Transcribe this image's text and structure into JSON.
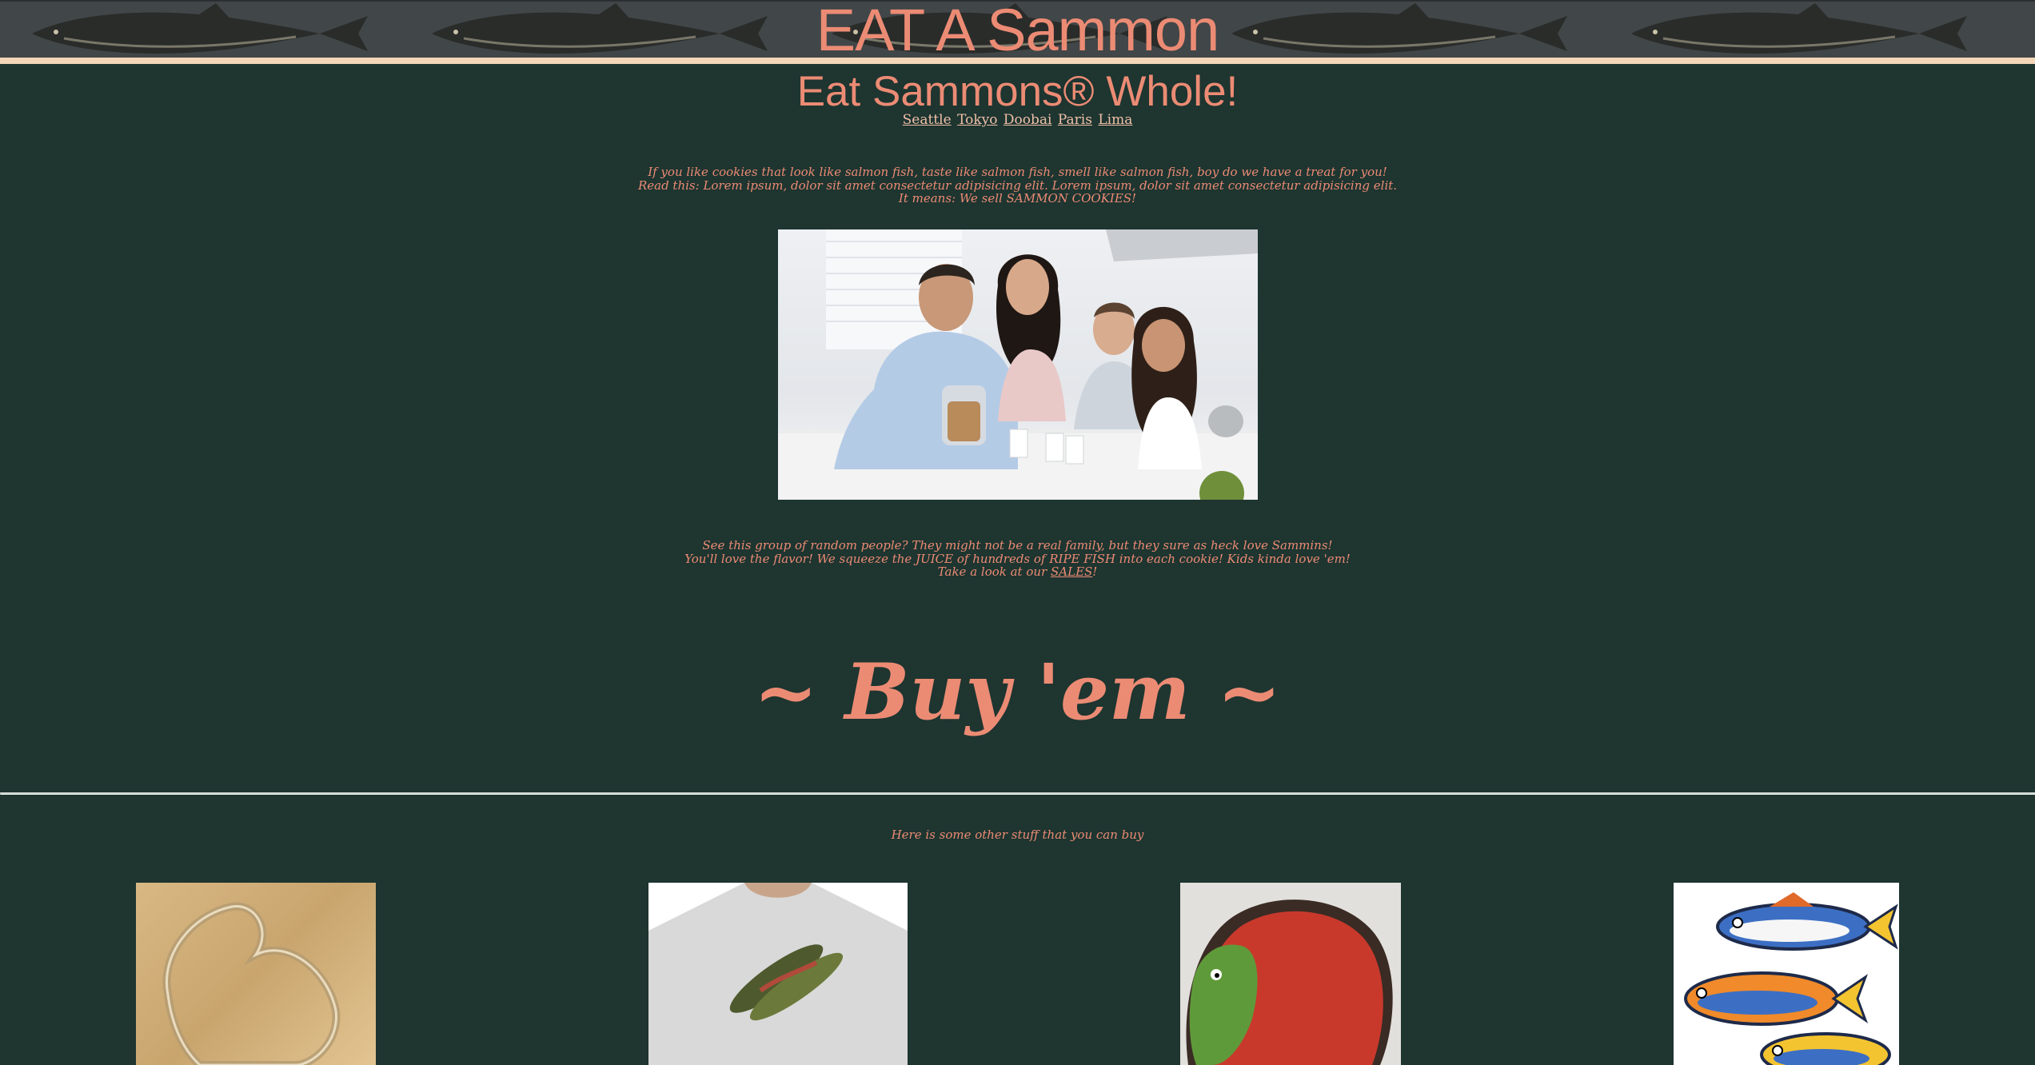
{
  "banner": {
    "title": "EAT A Sammon"
  },
  "header": {
    "subtitle": "Eat Sammons® Whole!",
    "cities": [
      "Seattle",
      "Tokyo",
      "Doobai",
      "Paris",
      "Lima"
    ]
  },
  "intro": {
    "line1": "If you like cookies that look like salmon fish, taste like salmon fish, smell like salmon fish, boy do we have a treat for you!",
    "line2": "Read this: Lorem ipsum, dolor sit amet consectetur adipisicing elit. Lorem ipsum, dolor sit amet consectetur adipisicing elit.",
    "line3": "It means: We sell SAMMON COOKIES!"
  },
  "family": {
    "line1": "See this group of random people? They might not be a real family, but they sure as heck love Sammins!",
    "line2": "You'll love the flavor! We squeeze the JUICE of hundreds of RIPE FISH into each cookie! Kids kinda love 'em!",
    "line3_prefix": "Take a look at our ",
    "sales_link": "SALES",
    "line3_suffix": "!"
  },
  "buy": {
    "title": "~ Buy 'em ~",
    "other_stuff": "Here is some other stuff that you can buy"
  },
  "colors": {
    "background": "#1e3530",
    "accent": "#ec8b74",
    "banner": "#414648",
    "stripe": "#f2d6b8"
  },
  "icons": {
    "banner_fish": "salmon-fish-icon",
    "product_1": "fish-cookie-cutter",
    "product_2": "salmon-tshirt",
    "product_3": "iced-salmon-cookie",
    "product_4": "colorful-fish-cookies"
  }
}
